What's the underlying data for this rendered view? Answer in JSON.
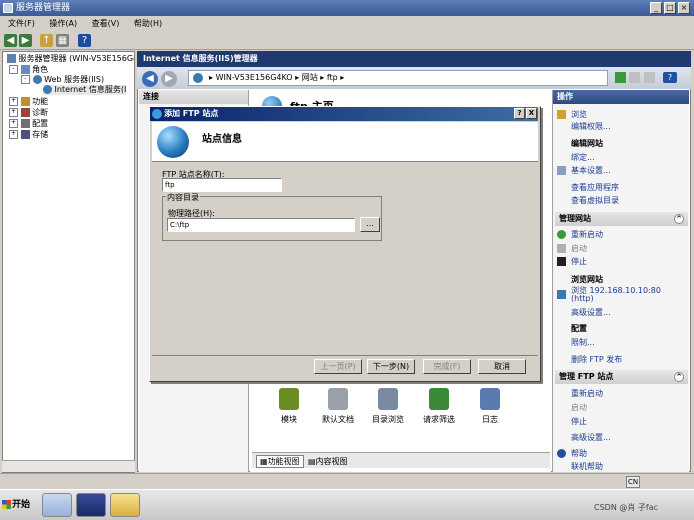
{
  "window": {
    "title": "服务器管理器"
  },
  "menu": [
    "文件(F)",
    "操作(A)",
    "查看(V)",
    "帮助(H)"
  ],
  "tree": {
    "root": "服务器管理器 (WIN-V53E156G4K",
    "roles": "角色",
    "web_server": "Web 服务器(IIS)",
    "iis_manager": "Internet 信息服务(I",
    "features": "功能",
    "diagnostics": "诊断",
    "config": "配置",
    "storage": "存储"
  },
  "iis": {
    "header": "Internet 信息服务(IIS)管理器",
    "breadcrumb": [
      "WIN-V53E156G4KO",
      "网站",
      "ftp"
    ],
    "connections_label": "连接",
    "home_title": "ftp 主页"
  },
  "features": [
    {
      "label": "模块",
      "icon": "modules-icon",
      "color": "#6b8e23"
    },
    {
      "label": "默认文档",
      "icon": "default-document-icon",
      "color": "#9aa0a8"
    },
    {
      "label": "目录浏览",
      "icon": "directory-browsing-icon",
      "color": "#7a8aa0"
    },
    {
      "label": "请求筛选",
      "icon": "request-filtering-icon",
      "color": "#3a8a3a"
    },
    {
      "label": "日志",
      "icon": "logging-icon",
      "color": "#5a7ab0"
    }
  ],
  "view_tabs": {
    "features_view": "功能视图",
    "content_view": "内容视图"
  },
  "actions": {
    "header": "操作",
    "browse": "浏览",
    "edit_permissions": "编辑权限...",
    "edit_site": "编辑网站",
    "bindings": "绑定...",
    "basic_settings": "基本设置...",
    "view_apps": "查看应用程序",
    "view_vdirs": "查看虚拟目录",
    "manage_site": "管理网站",
    "restart": "重新启动",
    "start": "启动",
    "stop": "停止",
    "browse_site": "浏览网站",
    "browse_addr": "浏览 192.168.10.10:80",
    "browse_proto": "(http)",
    "advanced": "高级设置...",
    "configure": "配置",
    "limits": "限制...",
    "delete_ftp": "删除 FTP 发布",
    "manage_ftp": "管理 FTP 站点",
    "ftp_restart": "重新启动",
    "ftp_start": "启动",
    "ftp_stop": "停止",
    "ftp_advanced": "高级设置...",
    "help": "帮助",
    "online_help": "联机帮助"
  },
  "dialog": {
    "title": "添加 FTP 站点",
    "help_btn": "?",
    "close_btn": "X",
    "heading": "站点信息",
    "site_name_label": "FTP 站点名称(T):",
    "site_name_value": "ftp",
    "content_dir_label": "内容目录",
    "physical_path_label": "物理路径(H):",
    "physical_path_value": "C:\\ftp",
    "browse_btn": "...",
    "prev": "上一页(P)",
    "next": "下一步(N)",
    "finish": "完成(F)",
    "cancel": "取消"
  },
  "taskbar": {
    "start": "开始",
    "lang": "CN",
    "watermark": "CSDN @肖 子fac"
  }
}
